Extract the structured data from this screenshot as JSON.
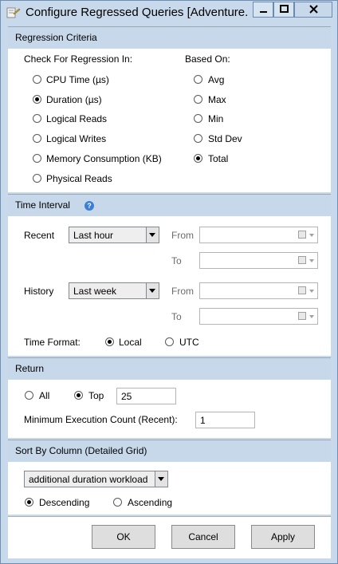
{
  "window": {
    "title": "Configure Regressed Queries [Adventure..."
  },
  "regression": {
    "header": "Regression Criteria",
    "check_label": "Check For Regression In:",
    "based_label": "Based On:",
    "metrics": [
      "CPU Time (µs)",
      "Duration (µs)",
      "Logical Reads",
      "Logical Writes",
      "Memory Consumption (KB)",
      "Physical Reads"
    ],
    "selected_metric": "Duration (µs)",
    "aggregations": [
      "Avg",
      "Max",
      "Min",
      "Std Dev",
      "Total"
    ],
    "selected_aggregation": "Total"
  },
  "time_interval": {
    "header": "Time Interval",
    "recent_label": "Recent",
    "recent_value": "Last hour",
    "history_label": "History",
    "history_value": "Last week",
    "from_label": "From",
    "to_label": "To",
    "time_format_label": "Time Format:",
    "local_label": "Local",
    "utc_label": "UTC",
    "selected_format": "Local"
  },
  "return_section": {
    "header": "Return",
    "all_label": "All",
    "top_label": "Top",
    "top_value": "25",
    "selected": "Top",
    "min_exec_label": "Minimum Execution Count (Recent):",
    "min_exec_value": "1"
  },
  "sort": {
    "header": "Sort By Column (Detailed Grid)",
    "column_value": "additional duration workload",
    "descending_label": "Descending",
    "ascending_label": "Ascending",
    "selected": "Descending"
  },
  "buttons": {
    "ok": "OK",
    "cancel": "Cancel",
    "apply": "Apply"
  }
}
